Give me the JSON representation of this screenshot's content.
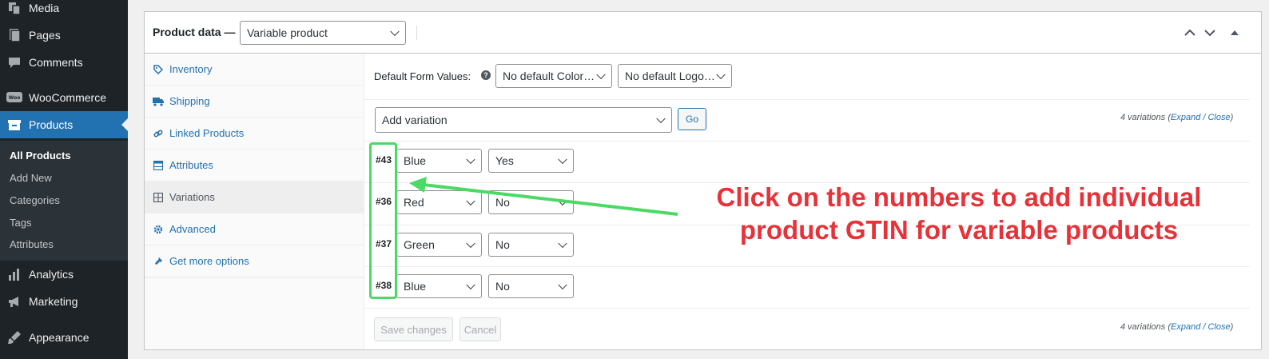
{
  "sidebar": {
    "menu": [
      {
        "label": "Media",
        "icon": "media-icon"
      },
      {
        "label": "Pages",
        "icon": "pages-icon"
      },
      {
        "label": "Comments",
        "icon": "comments-icon"
      },
      {
        "label": "WooCommerce",
        "icon": "woocommerce-icon"
      },
      {
        "label": "Products",
        "icon": "products-icon",
        "active": true
      },
      {
        "label": "Analytics",
        "icon": "analytics-icon"
      },
      {
        "label": "Marketing",
        "icon": "marketing-icon"
      },
      {
        "label": "Appearance",
        "icon": "appearance-icon"
      }
    ],
    "submenu": [
      "All Products",
      "Add New",
      "Categories",
      "Tags",
      "Attributes"
    ],
    "submenu_current": "All Products"
  },
  "product_data": {
    "title": "Product data —",
    "type_select": "Variable product",
    "tabs": [
      {
        "label": "Inventory",
        "icon": "tag-icon"
      },
      {
        "label": "Shipping",
        "icon": "truck-icon"
      },
      {
        "label": "Linked Products",
        "icon": "link-icon"
      },
      {
        "label": "Attributes",
        "icon": "table-icon"
      },
      {
        "label": "Variations",
        "icon": "grid-icon",
        "active": true
      },
      {
        "label": "Advanced",
        "icon": "gear-icon"
      },
      {
        "label": "Get more options",
        "icon": "plugin-icon"
      }
    ]
  },
  "variations": {
    "default_form_label": "Default Form Values:",
    "default_color": "No default Color…",
    "default_logo": "No default Logo…",
    "add_variation": "Add variation",
    "go": "Go",
    "count_text": "4 variations",
    "expand": "Expand",
    "slash": " / ",
    "close": "Close",
    "rows": [
      {
        "number": "#43",
        "color": "Blue",
        "logo": "Yes"
      },
      {
        "number": "#36",
        "color": "Red",
        "logo": "No"
      },
      {
        "number": "#37",
        "color": "Green",
        "logo": "No"
      },
      {
        "number": "#38",
        "color": "Blue",
        "logo": "No"
      }
    ],
    "save_changes": "Save changes",
    "cancel": "Cancel"
  },
  "annotation": {
    "line1": "Click on the numbers to add individual",
    "line2": "product GTIN for variable products",
    "color": "#e6333a",
    "highlight_color": "#4cd964"
  },
  "colors": {
    "sidebar_bg": "#1d2327",
    "accent": "#2271b1"
  }
}
